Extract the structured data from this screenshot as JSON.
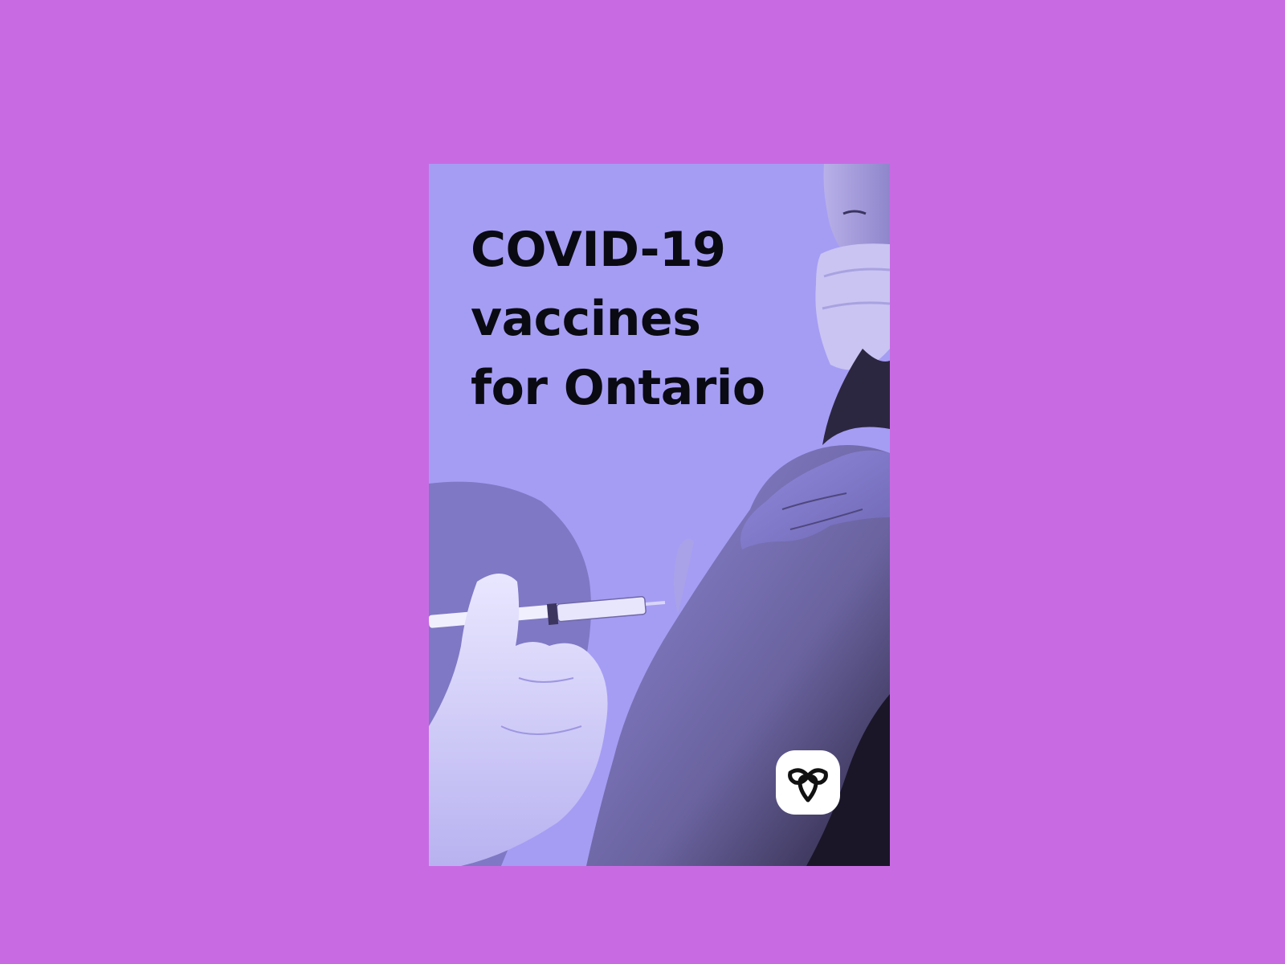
{
  "page": {
    "background_color": "#c86be3"
  },
  "poster": {
    "background_color": "#a59df4",
    "title_lines": [
      "COVID-19",
      "vaccines",
      "for Ontario"
    ],
    "title_color": "#0a0a12",
    "logo": {
      "icon": "ontario-trillium-icon",
      "background_color": "#ffffff"
    }
  }
}
